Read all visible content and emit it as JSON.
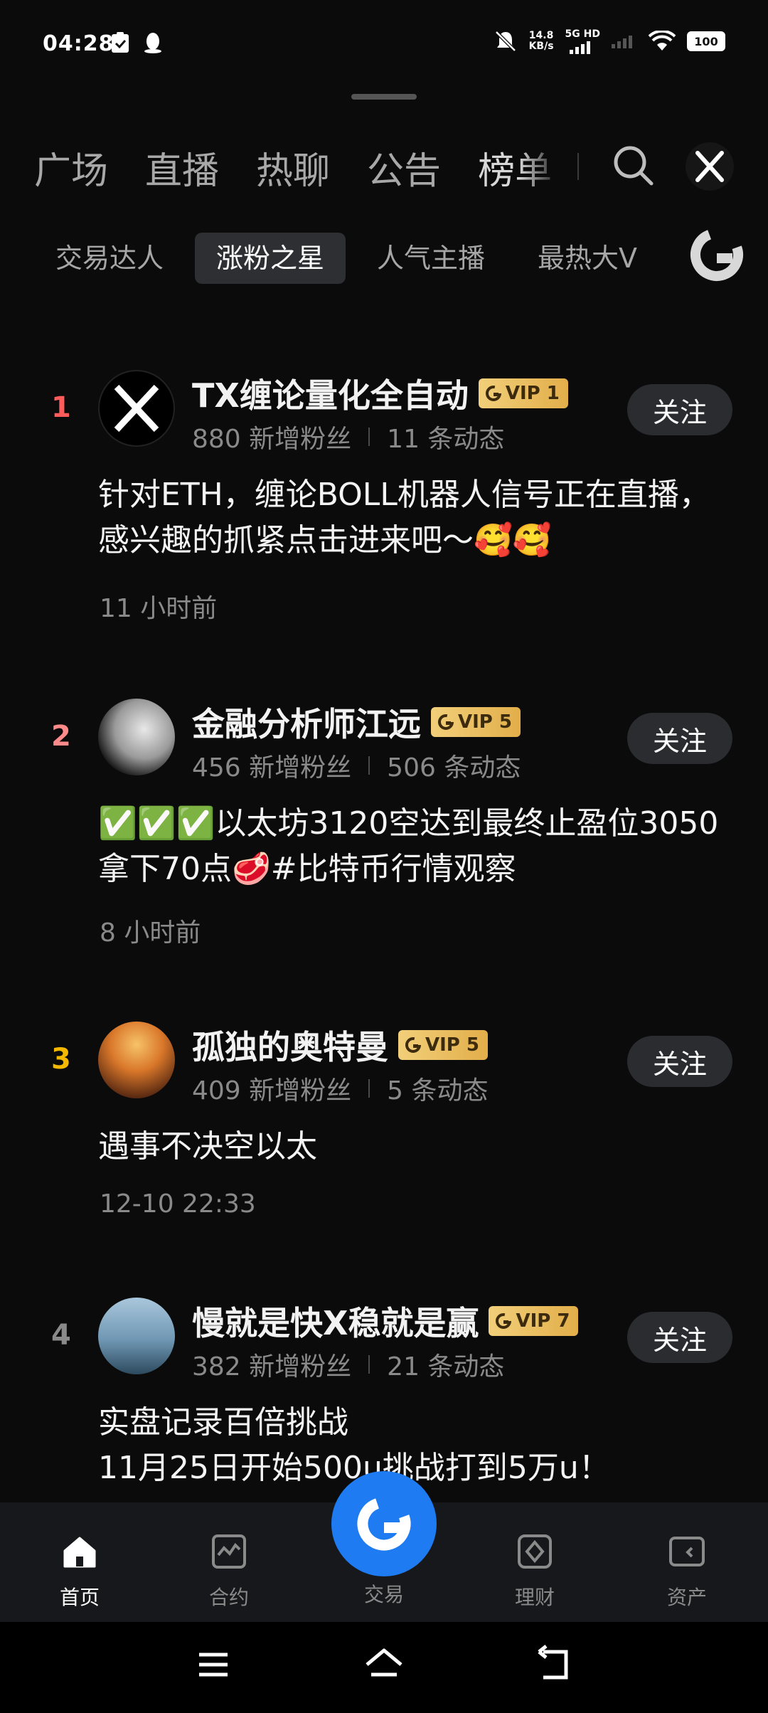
{
  "status_bar": {
    "time": "04:28",
    "net_speed_value": "14.8",
    "net_speed_unit": "KB/s",
    "network_type": "5G HD",
    "battery": "100"
  },
  "top_tabs": [
    "广场",
    "直播",
    "热聊",
    "公告",
    "榜单"
  ],
  "sub_tabs": [
    {
      "label": "交易达人",
      "active": false
    },
    {
      "label": "涨粉之星",
      "active": true
    },
    {
      "label": "人气主播",
      "active": false
    },
    {
      "label": "最热大V",
      "active": false
    }
  ],
  "follow_label": "关注",
  "items": [
    {
      "rank": "1",
      "rank_color": "#ff5b5b",
      "name": "TX缠论量化全自动",
      "vip": "VIP 1",
      "fans": "880 新增粉丝",
      "posts": "11 条动态",
      "content": "针对ETH，缠论BOLL机器人信号正在直播，感兴趣的抓紧点击进来吧～🥰🥰",
      "time": "11 小时前"
    },
    {
      "rank": "2",
      "rank_color": "#ff8a8a",
      "name": "金融分析师江远",
      "vip": "VIP 5",
      "fans": "456 新增粉丝",
      "posts": "506 条动态",
      "content": "✅✅✅以太坊3120空达到最终止盈位3050拿下70点🥩#比特币行情观察",
      "time": "8 小时前"
    },
    {
      "rank": "3",
      "rank_color": "#f5b800",
      "name": "孤独的奥特曼",
      "vip": "VIP 5",
      "fans": "409 新增粉丝",
      "posts": "5 条动态",
      "content": "遇事不决空以太",
      "time": "12-10 22:33"
    },
    {
      "rank": "4",
      "rank_color": "#8a8a8a",
      "name": "慢就是快X稳就是赢",
      "vip": "VIP 7",
      "fans": "382 新增粉丝",
      "posts": "21 条动态",
      "content": "实盘记录百倍挑战\n11月25日开始500u挑战打到5万u！",
      "time": ""
    }
  ],
  "bottom_nav": [
    {
      "label": "首页",
      "icon": "home-icon",
      "active": true
    },
    {
      "label": "合约",
      "icon": "contract-icon",
      "active": false
    },
    {
      "label": "交易",
      "icon": "trade-icon",
      "active": false
    },
    {
      "label": "理财",
      "icon": "finance-icon",
      "active": false
    },
    {
      "label": "资产",
      "icon": "assets-icon",
      "active": false
    }
  ],
  "colors": {
    "accent_blue": "#1e7bf2",
    "vip_gold": "#e8b95a",
    "background": "#0b0b0b"
  }
}
